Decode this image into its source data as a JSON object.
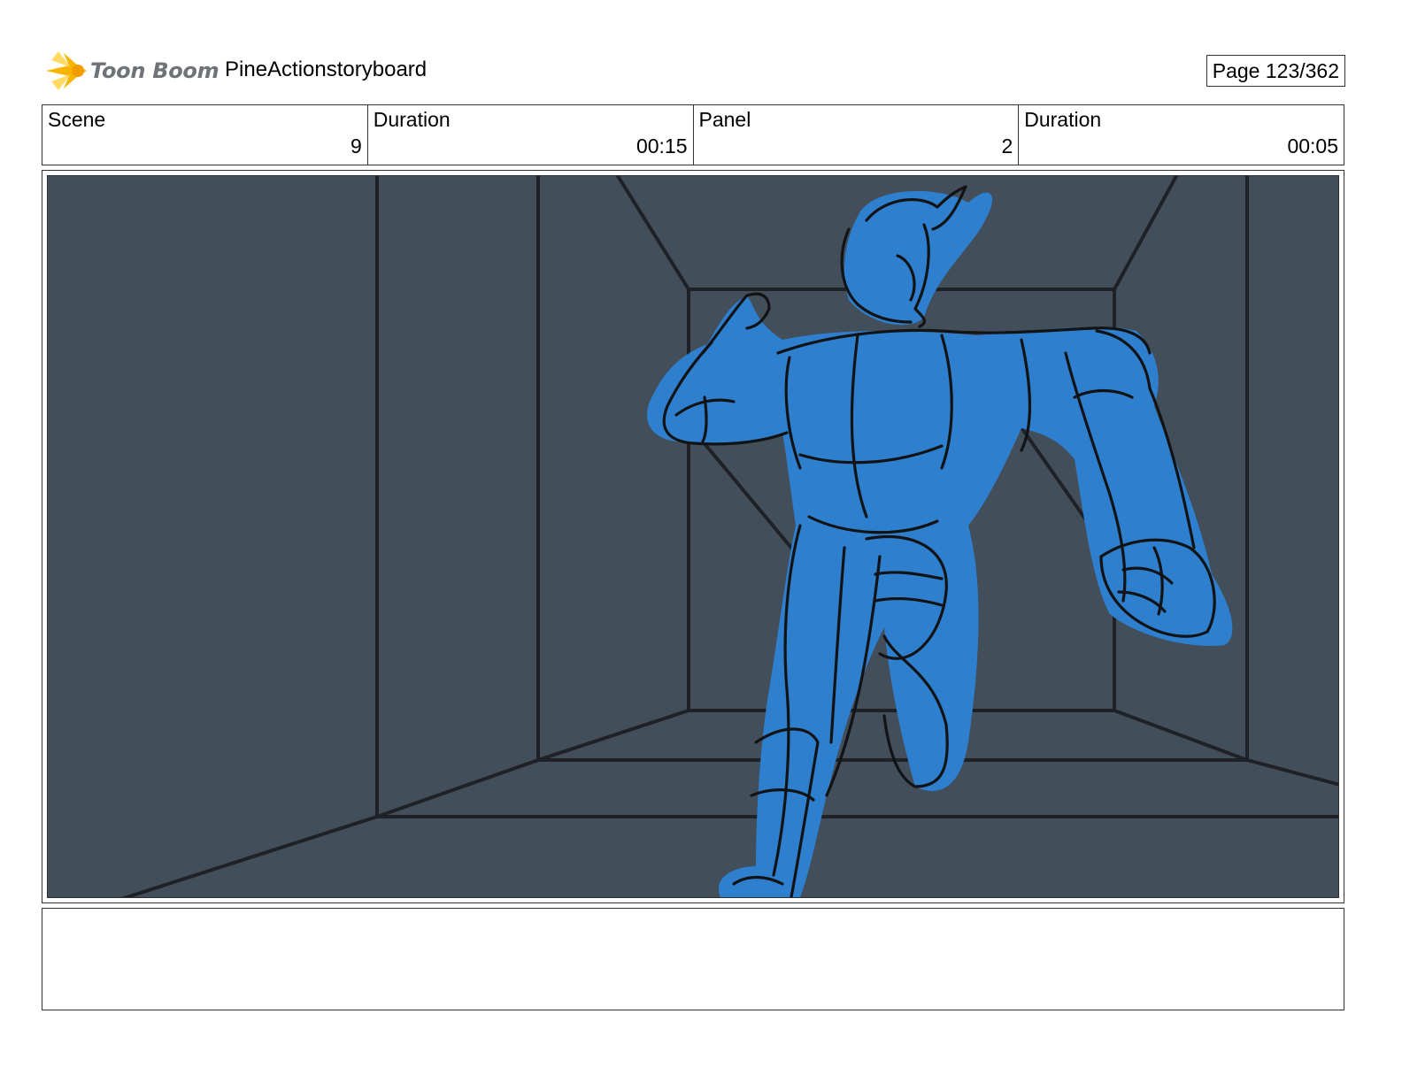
{
  "header": {
    "logo_text": "Toon Boom",
    "project_title": "PineActionstoryboard",
    "page_label": "Page 123/362"
  },
  "info": {
    "scene_label": "Scene",
    "scene_value": "9",
    "scene_duration_label": "Duration",
    "scene_duration_value": "00:15",
    "panel_label": "Panel",
    "panel_value": "2",
    "panel_duration_label": "Duration",
    "panel_duration_value": "00:05"
  },
  "colors": {
    "background_fill": "#424e59",
    "character_fill": "#2f7fcf",
    "line_color": "#1a1d20",
    "logo_accent": "#f7b500"
  },
  "notes": {
    "text": ""
  }
}
